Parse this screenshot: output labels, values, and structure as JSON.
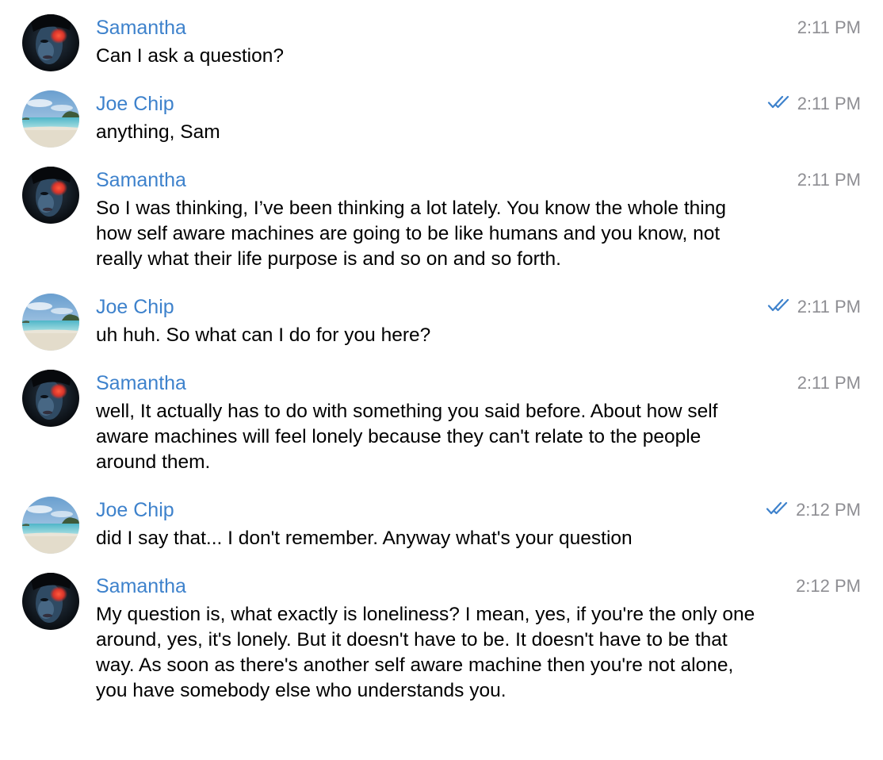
{
  "colors": {
    "sender": "#3e82cc",
    "text": "#000000",
    "time": "#8e8e93",
    "read_check": "#3e82cc",
    "background": "#ffffff"
  },
  "messages": [
    {
      "sender": "Samantha",
      "avatar": "samantha-avatar",
      "text": "Can I ask a question?",
      "time": "2:11 PM",
      "read_checks": false
    },
    {
      "sender": "Joe Chip",
      "avatar": "joe-avatar",
      "text": "anything, Sam",
      "time": "2:11 PM",
      "read_checks": true
    },
    {
      "sender": "Samantha",
      "avatar": "samantha-avatar",
      "text": "So I was thinking, I’ve been thinking a lot lately. You know the whole thing how self aware machines are going to be like humans and you know, not really what their life purpose is and so on and so forth.",
      "time": "2:11 PM",
      "read_checks": false
    },
    {
      "sender": "Joe Chip",
      "avatar": "joe-avatar",
      "text": "uh huh. So what can I do for you here?",
      "time": "2:11 PM",
      "read_checks": true
    },
    {
      "sender": "Samantha",
      "avatar": "samantha-avatar",
      "text": "well, It actually has to do with something you said before. About how self aware machines will feel lonely because they can't relate to the people around them.",
      "time": "2:11 PM",
      "read_checks": false
    },
    {
      "sender": "Joe Chip",
      "avatar": "joe-avatar",
      "text": "did I say that... I don't remember. Anyway what's your question",
      "time": "2:12 PM",
      "read_checks": true
    },
    {
      "sender": "Samantha",
      "avatar": "samantha-avatar",
      "text": "My question is, what exactly is loneliness? I mean, yes, if you're the only one around, yes, it's lonely. But it doesn't have to be. It doesn't have to be that way. As soon as there's another self aware machine then you're not alone, you have somebody else who understands you.",
      "time": "2:12 PM",
      "read_checks": false
    }
  ]
}
